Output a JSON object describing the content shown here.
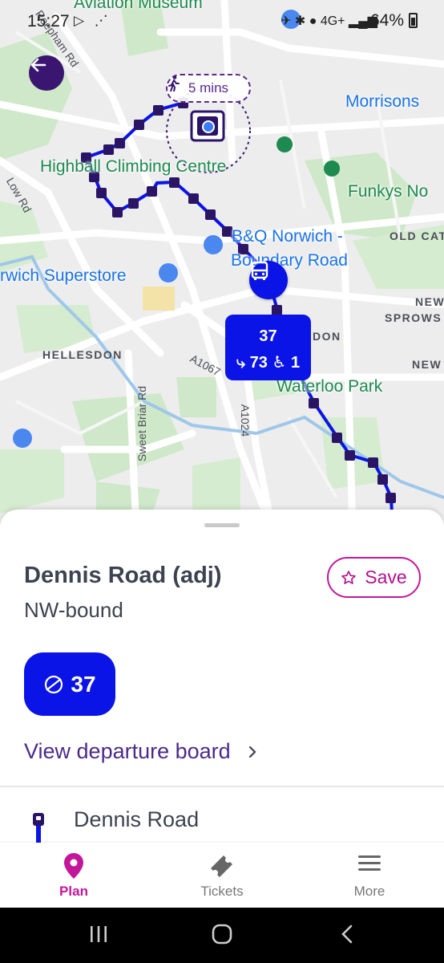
{
  "status_bar": {
    "time": "15:27",
    "battery": "64%",
    "network": "4G+"
  },
  "map": {
    "labels": {
      "aviation_museum": "Aviation Museum",
      "morrisons": "Morrisons",
      "highball": "Highball Climbing Centre",
      "funkys": "Funkys No",
      "bq": "B&Q Norwich -",
      "bq2": "Boundary Road",
      "superstore": "rwich Superstore",
      "hellesdon": "HELLESDON",
      "waterloo": "Waterloo Park",
      "old_cat": "OLD CAT",
      "new_sprows": "NEW",
      "new_sprows2": "SPROWS",
      "new2": "NEW",
      "don": "DON",
      "a1067": "A1067",
      "a1024": "A1024",
      "sweet_briar": "Sweet Briar Rd",
      "low_rd": "Low Rd",
      "reepham": "Reepham Rd"
    },
    "walk_time": "5 mins",
    "route_callout": {
      "route": "37",
      "seats": "73",
      "wheelchair": "1"
    }
  },
  "sheet": {
    "stop_title": "Dennis Road (adj)",
    "bound": "NW-bound",
    "save_label": "Save",
    "route_chip": "37",
    "departure_link": "View departure board",
    "stop_list": [
      "Dennis Road"
    ]
  },
  "nav": {
    "plan": "Plan",
    "tickets": "Tickets",
    "more": "More"
  },
  "colors": {
    "bus_blue": "#0a14e6",
    "accent_magenta": "#c3179b",
    "dark_purple": "#3a1670"
  },
  "icons": [
    "back-arrow-icon",
    "walk-icon",
    "bus-icon",
    "star-icon",
    "route-icon",
    "chevron-right-icon",
    "location-pin-icon",
    "ticket-icon",
    "menu-icon"
  ]
}
